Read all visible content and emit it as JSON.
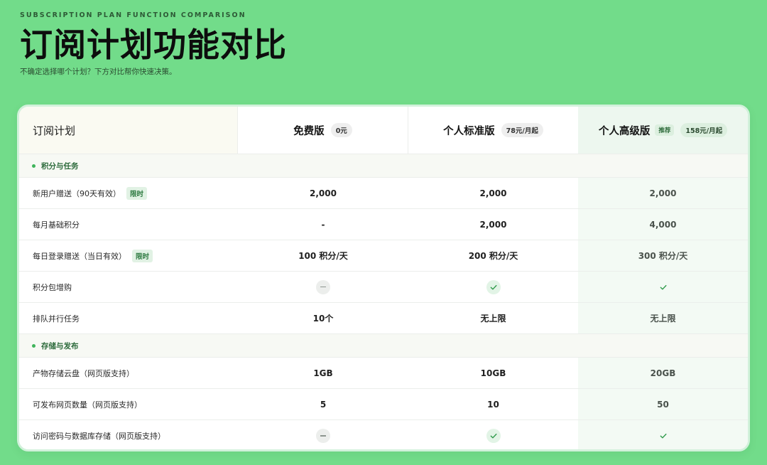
{
  "header": {
    "eyebrow": "SUBSCRIPTION PLAN FUNCTION COMPARISON",
    "title": "订阅计划功能对比",
    "subtitle": "不确定选择哪个计划？下方对比帮你快速决策。"
  },
  "table": {
    "corner": "订阅计划",
    "plans": [
      {
        "name": "免费版",
        "price": "0元"
      },
      {
        "name": "个人标准版",
        "price": "78元/月起"
      },
      {
        "name": "个人高级版",
        "badge": "推荐",
        "price": "158元/月起"
      }
    ],
    "sections": [
      {
        "title": "积分与任务",
        "rows": [
          {
            "label": "新用户赠送（90天有效）",
            "tag": "限时",
            "values": [
              "2,000",
              "2,000",
              "2,000"
            ]
          },
          {
            "label": "每月基础积分",
            "values": [
              "-",
              "2,000",
              "4,000"
            ]
          },
          {
            "label": "每日登录赠送（当日有效）",
            "tag": "限时",
            "values": [
              "100 积分/天",
              "200 积分/天",
              "300 积分/天"
            ]
          },
          {
            "label": "积分包增购",
            "values": [
              "dash",
              "check",
              "check"
            ]
          },
          {
            "label": "排队并行任务",
            "values": [
              "10个",
              "无上限",
              "无上限"
            ]
          }
        ]
      },
      {
        "title": "存储与发布",
        "rows": [
          {
            "label": "产物存储云盘（网页版支持）",
            "values": [
              "1GB",
              "10GB",
              "20GB"
            ]
          },
          {
            "label": "可发布网页数量（网页版支持）",
            "values": [
              "5",
              "10",
              "50"
            ]
          },
          {
            "label": "访问密码与数据库存储（网页版支持）",
            "values": [
              "dash",
              "check",
              "check"
            ]
          }
        ]
      }
    ]
  },
  "colors": {
    "background": "#72dc8a",
    "accent": "#3fb45b",
    "check": "#2f9a4b"
  },
  "icons": {
    "check": "check-icon",
    "dash": "dash-icon"
  }
}
